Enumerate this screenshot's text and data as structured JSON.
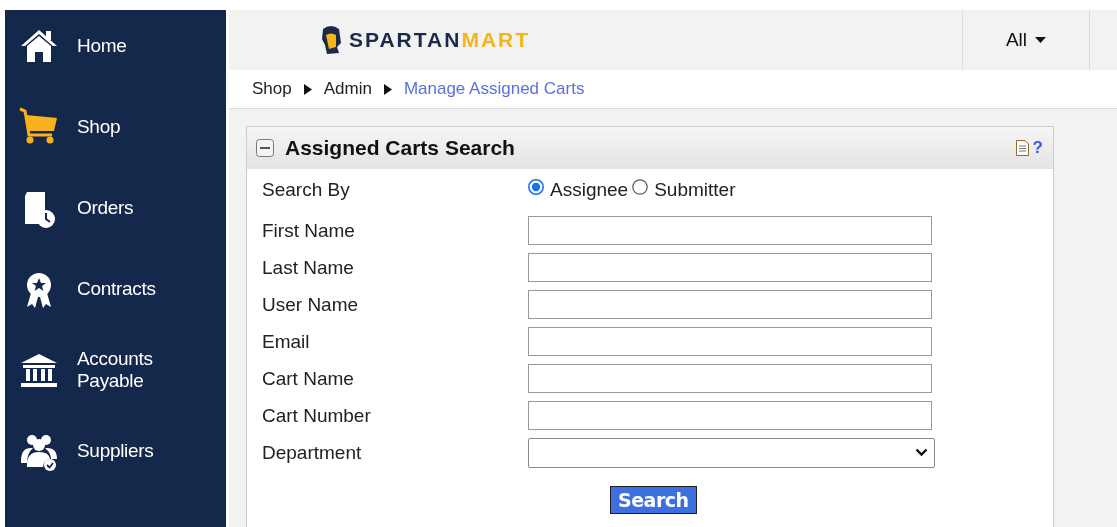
{
  "sidebar": {
    "items": [
      {
        "label": "Home",
        "selected": false
      },
      {
        "label": "Shop",
        "selected": true
      },
      {
        "label": "Orders",
        "selected": false
      },
      {
        "label": "Contracts",
        "selected": false
      },
      {
        "label": "Accounts Payable",
        "selected": false
      },
      {
        "label": "Suppliers",
        "selected": false
      }
    ]
  },
  "header": {
    "logo": {
      "main": "SPARTAN",
      "accent": "MART"
    },
    "scope_menu": {
      "label": "All"
    }
  },
  "breadcrumb": [
    {
      "label": "Shop",
      "current": false
    },
    {
      "label": "Admin",
      "current": false
    },
    {
      "label": "Manage Assigned Carts",
      "current": true
    }
  ],
  "panel": {
    "title": "Assigned Carts Search",
    "help": "?",
    "search_by": {
      "label": "Search By",
      "options": [
        {
          "label": "Assignee",
          "selected": true
        },
        {
          "label": "Submitter",
          "selected": false
        }
      ]
    },
    "fields": [
      {
        "label": "First Name",
        "kind": "text"
      },
      {
        "label": "Last Name",
        "kind": "text"
      },
      {
        "label": "User Name",
        "kind": "text"
      },
      {
        "label": "Email",
        "kind": "text"
      },
      {
        "label": "Cart Name",
        "kind": "text"
      },
      {
        "label": "Cart Number",
        "kind": "text"
      },
      {
        "label": "Department",
        "kind": "select"
      }
    ],
    "button": "Search"
  }
}
